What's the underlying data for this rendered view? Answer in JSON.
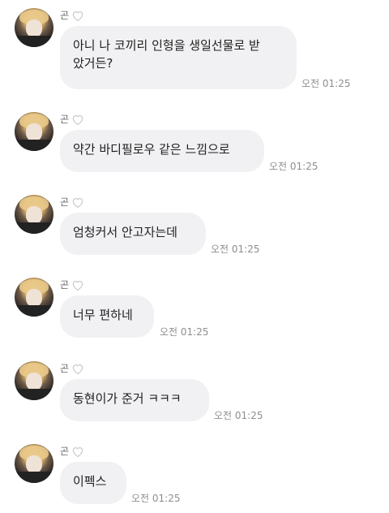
{
  "messages": [
    {
      "sender": "곤",
      "text": "아니 나 코끼리 인형을 생일선물로 받\n았거든?",
      "time": "오전 01:25"
    },
    {
      "sender": "곤",
      "text": "약간 바디필로우 같은 느낌으로",
      "time": "오전 01:25"
    },
    {
      "sender": "곤",
      "text": "엄청커서 안고자는데",
      "time": "오전 01:25"
    },
    {
      "sender": "곤",
      "text": "너무 편하네",
      "time": "오전 01:25"
    },
    {
      "sender": "곤",
      "text": "동현이가 준거 ㅋㅋㅋ",
      "time": "오전 01:25"
    },
    {
      "sender": "곤",
      "text": "이펙스",
      "time": "오전 01:25"
    }
  ],
  "icons": {
    "heart": "heart-outline-icon",
    "heart_color": "#c9c9c9"
  }
}
